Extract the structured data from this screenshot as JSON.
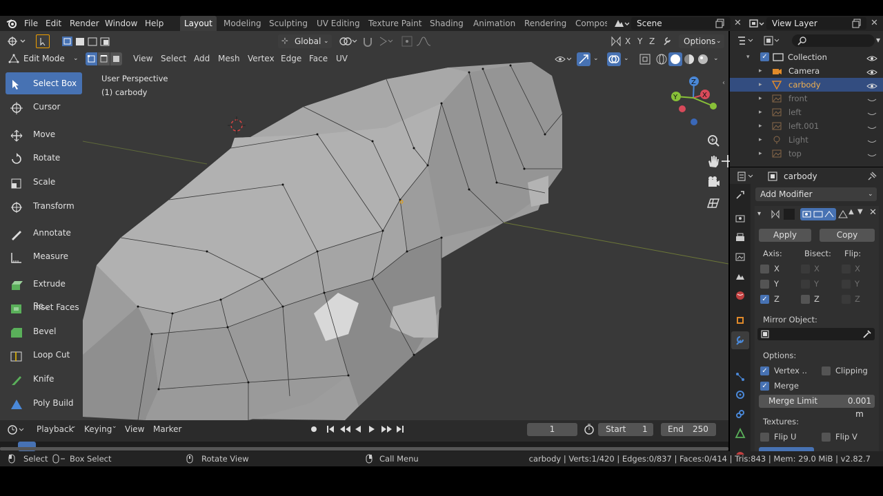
{
  "topbar": {
    "menus": [
      "File",
      "Edit",
      "Render",
      "Window",
      "Help"
    ],
    "workspaces": [
      "Layout",
      "Modeling",
      "Sculpting",
      "UV Editing",
      "Texture Paint",
      "Shading",
      "Animation",
      "Rendering",
      "Compos"
    ],
    "scene_label": "Scene",
    "view_layer_label": "View Layer"
  },
  "viewport_header": {
    "transform_orientation": "Global",
    "axes": [
      "X",
      "Y",
      "Z"
    ],
    "options_label": "Options",
    "mode": "Edit Mode",
    "menus": [
      "View",
      "Select",
      "Add",
      "Mesh",
      "Vertex",
      "Edge",
      "Face",
      "UV"
    ]
  },
  "viewport": {
    "perspective_label": "User Perspective",
    "object_label": "(1) carbody"
  },
  "tools": [
    {
      "label": "Select Box",
      "icon": "select-box-icon",
      "selected": true
    },
    {
      "label": "Cursor",
      "icon": "cursor-icon",
      "selected": false
    },
    {
      "label": "Move",
      "icon": "move-icon",
      "selected": false
    },
    {
      "label": "Rotate",
      "icon": "rotate-icon",
      "selected": false
    },
    {
      "label": "Scale",
      "icon": "scale-icon",
      "selected": false
    },
    {
      "label": "Transform",
      "icon": "transform-icon",
      "selected": false
    },
    {
      "label": "Annotate",
      "icon": "annotate-icon",
      "selected": false
    },
    {
      "label": "Measure",
      "icon": "measure-icon",
      "selected": false
    },
    {
      "label": "Extrude Re..",
      "icon": "extrude-icon",
      "selected": false
    },
    {
      "label": "Inset Faces",
      "icon": "inset-icon",
      "selected": false
    },
    {
      "label": "Bevel",
      "icon": "bevel-icon",
      "selected": false
    },
    {
      "label": "Loop Cut",
      "icon": "loop-cut-icon",
      "selected": false
    },
    {
      "label": "Knife",
      "icon": "knife-icon",
      "selected": false
    },
    {
      "label": "Poly Build",
      "icon": "poly-build-icon",
      "selected": false
    }
  ],
  "outliner": {
    "items": [
      {
        "label": "Collection",
        "depth": 0,
        "dim": false,
        "selected": false
      },
      {
        "label": "Camera",
        "depth": 1,
        "dim": false,
        "selected": false
      },
      {
        "label": "carbody",
        "depth": 1,
        "dim": false,
        "selected": true
      },
      {
        "label": "front",
        "depth": 1,
        "dim": true,
        "selected": false
      },
      {
        "label": "left",
        "depth": 1,
        "dim": true,
        "selected": false
      },
      {
        "label": "left.001",
        "depth": 1,
        "dim": true,
        "selected": false
      },
      {
        "label": "Light",
        "depth": 1,
        "dim": true,
        "selected": false
      },
      {
        "label": "top",
        "depth": 1,
        "dim": true,
        "selected": false
      }
    ]
  },
  "properties": {
    "object_name": "carbody",
    "add_modifier_label": "Add Modifier",
    "apply_label": "Apply",
    "copy_label": "Copy",
    "axis_label": "Axis:",
    "bisect_label": "Bisect:",
    "flip_label": "Flip:",
    "axes": [
      "X",
      "Y",
      "Z"
    ],
    "mirror_object_label": "Mirror Object:",
    "options_label": "Options:",
    "vertex_label": "Vertex ..",
    "clipping_label": "Clipping",
    "merge_label": "Merge",
    "merge_limit_label": "Merge Limit",
    "merge_limit_value": "0.001 m",
    "textures_label": "Textures:",
    "flip_u_label": "Flip U",
    "flip_v_label": "Flip V"
  },
  "timeline": {
    "menus": [
      "Playback",
      "Keying",
      "View",
      "Marker"
    ],
    "current_frame": "1",
    "start_label": "Start",
    "start_value": "1",
    "end_label": "End",
    "end_value": "250"
  },
  "statusbar": {
    "select_label": "Select",
    "box_select_label": "Box Select",
    "rotate_view_label": "Rotate View",
    "call_menu_label": "Call Menu",
    "stats": "carbody | Verts:1/420 | Edges:0/837 | Faces:0/414 | Tris:843 | Mem: 29.0 MiB | v2.82.7"
  },
  "colors": {
    "accent": "#4772b3",
    "panel": "#2b2b2b",
    "viewport_bg": "#393939"
  }
}
